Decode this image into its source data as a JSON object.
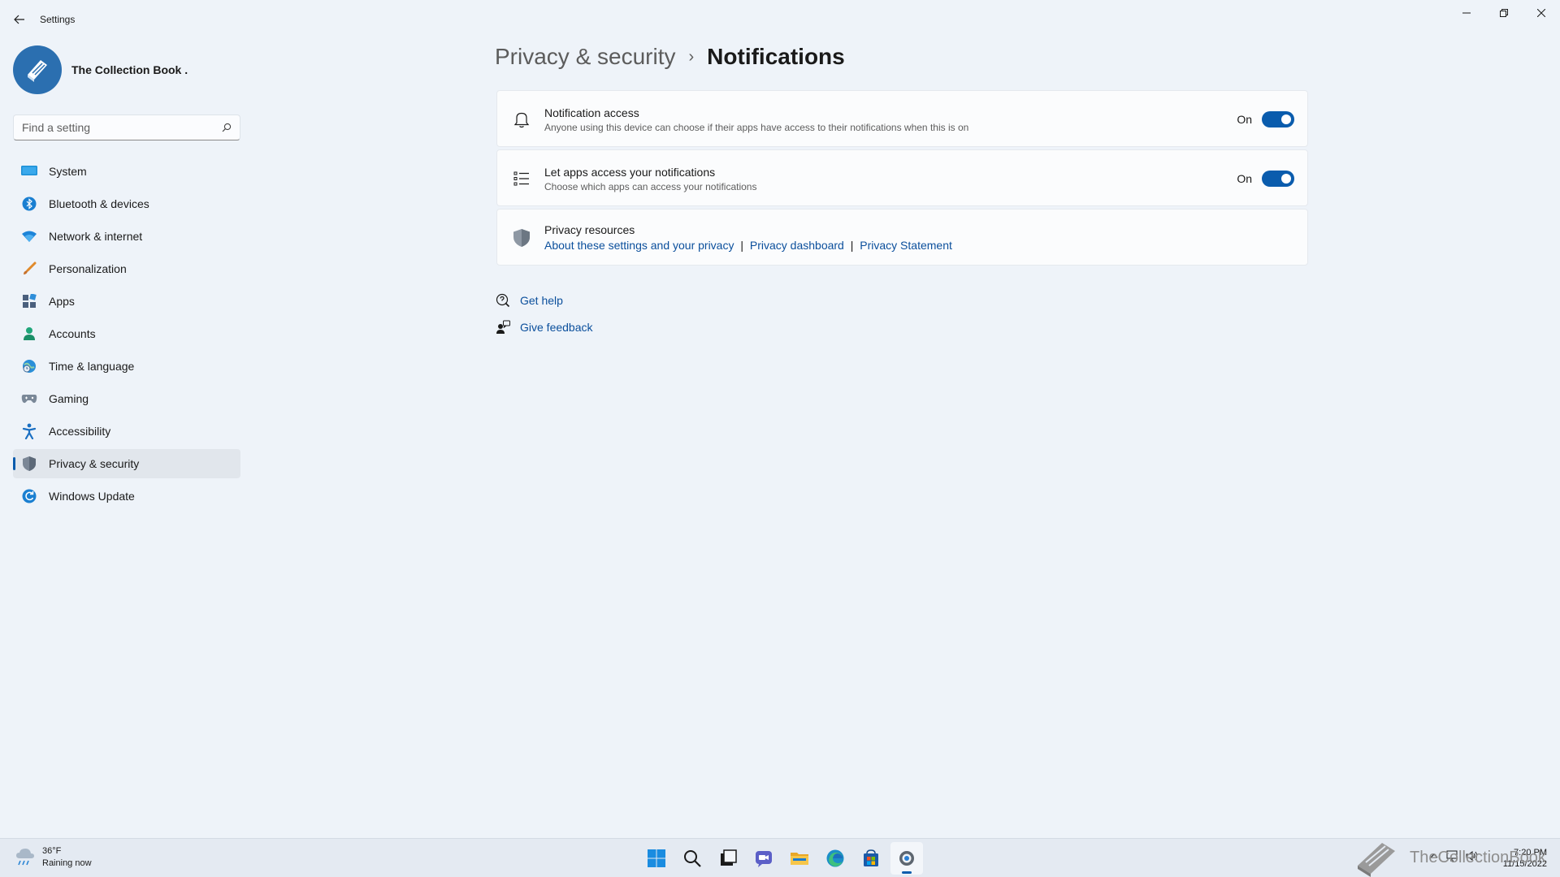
{
  "window": {
    "title": "Settings",
    "controls": [
      "minimize",
      "maximize",
      "close"
    ]
  },
  "profile": {
    "name": "The Collection Book ."
  },
  "search": {
    "placeholder": "Find a setting"
  },
  "sidebar": {
    "items": [
      {
        "label": "System",
        "icon": "system-icon"
      },
      {
        "label": "Bluetooth & devices",
        "icon": "bluetooth-icon"
      },
      {
        "label": "Network & internet",
        "icon": "wifi-icon"
      },
      {
        "label": "Personalization",
        "icon": "brush-icon"
      },
      {
        "label": "Apps",
        "icon": "apps-icon"
      },
      {
        "label": "Accounts",
        "icon": "account-icon"
      },
      {
        "label": "Time & language",
        "icon": "globe-clock-icon"
      },
      {
        "label": "Gaming",
        "icon": "gamepad-icon"
      },
      {
        "label": "Accessibility",
        "icon": "accessibility-icon"
      },
      {
        "label": "Privacy & security",
        "icon": "shield-icon",
        "active": true
      },
      {
        "label": "Windows Update",
        "icon": "update-icon"
      }
    ]
  },
  "breadcrumb": {
    "parent": "Privacy & security",
    "separator": "›",
    "current": "Notifications"
  },
  "settings": {
    "notification_access": {
      "title": "Notification access",
      "description": "Anyone using this device can choose if their apps have access to their notifications when this is on",
      "state_label": "On",
      "on": true
    },
    "let_apps_access": {
      "title": "Let apps access your notifications",
      "description": "Choose which apps can access your notifications",
      "state_label": "On",
      "on": true
    },
    "privacy_resources": {
      "title": "Privacy resources",
      "links": [
        "About these settings and your privacy",
        "Privacy dashboard",
        "Privacy Statement"
      ],
      "separator": "|"
    }
  },
  "help": {
    "get_help": "Get help",
    "give_feedback": "Give feedback"
  },
  "taskbar": {
    "weather_temp": "36°F",
    "weather_desc": "Raining now",
    "apps": [
      "windows-start-icon",
      "search-icon",
      "task-view-icon",
      "chat-icon",
      "file-explorer-icon",
      "edge-icon",
      "store-icon",
      "settings-icon"
    ],
    "time": "7:20 PM",
    "date": "11/15/2022"
  },
  "watermark": {
    "text": "TheCollectionBook"
  },
  "colors": {
    "accent": "#0a5cad",
    "background": "#eef3f9",
    "card": "#fbfcfd",
    "link": "#0b4f9c"
  }
}
